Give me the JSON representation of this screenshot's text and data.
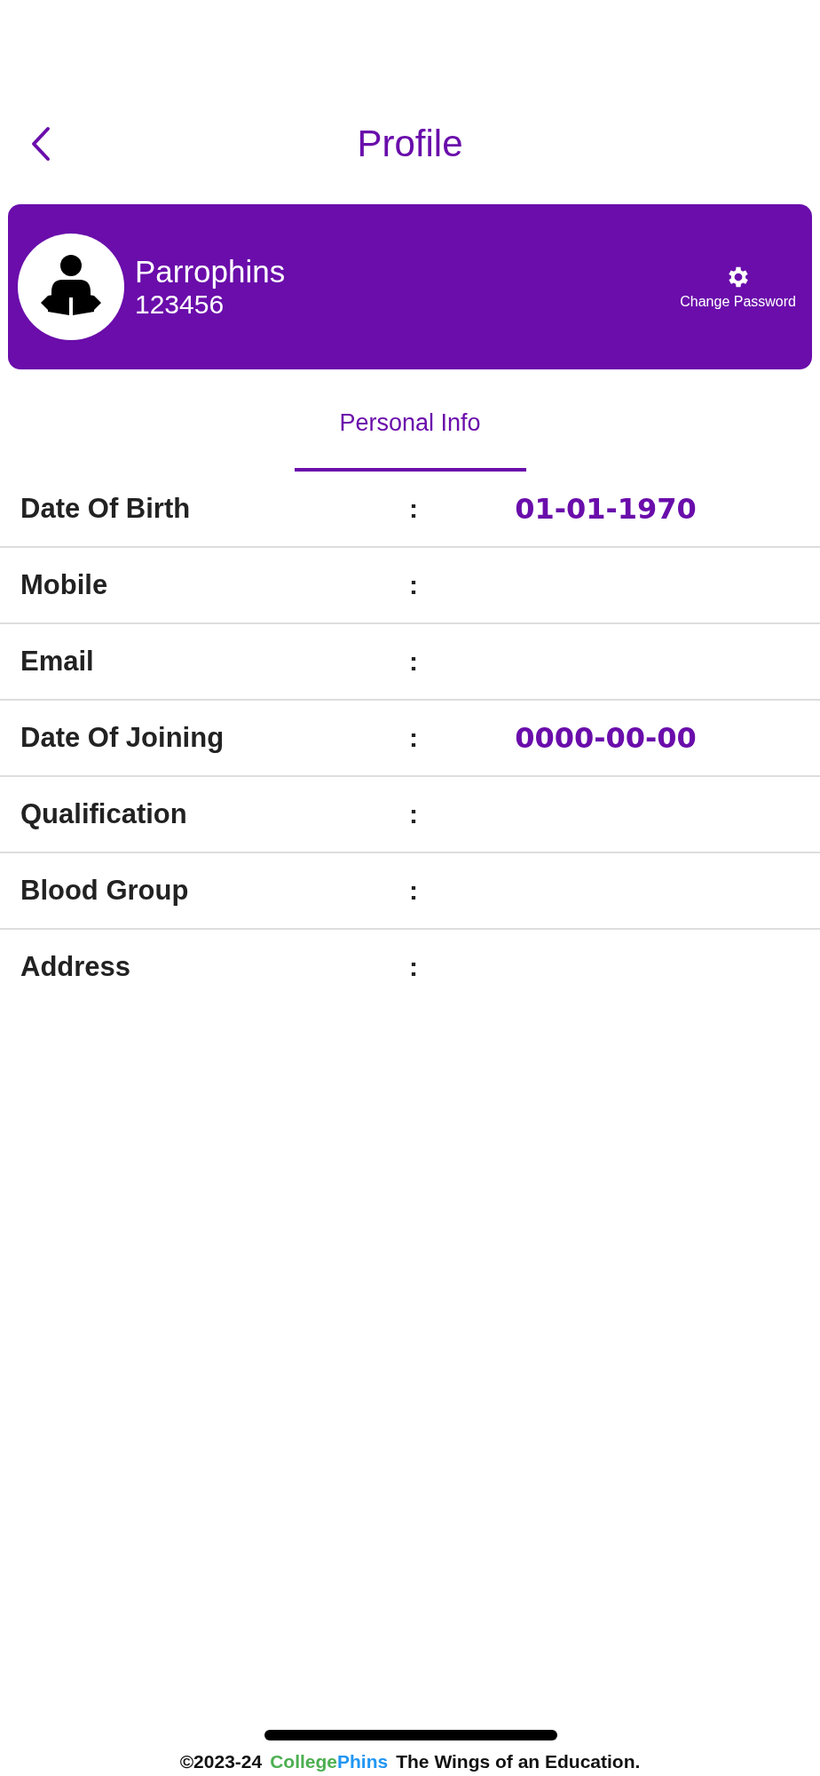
{
  "header": {
    "title": "Profile"
  },
  "profile": {
    "name": "Parrophins",
    "id": "123456",
    "action": "Change Password"
  },
  "tabs": [
    {
      "label": "Personal Info",
      "selected": true
    }
  ],
  "fields": [
    {
      "label": "Date Of Birth",
      "separator": ":",
      "value": "01-01-1970"
    },
    {
      "label": "Mobile",
      "separator": ":"
    },
    {
      "label": "Email",
      "separator": ":"
    },
    {
      "label": "Date Of Joining",
      "separator": ":",
      "value": "0000-00-00"
    },
    {
      "label": "Qualification",
      "separator": ":"
    },
    {
      "label": "Blood Group",
      "separator": ":"
    },
    {
      "label": "Address",
      "separator": ":"
    }
  ],
  "footer": {
    "copyright": "©2023-24",
    "brand": [
      {
        "text": "College",
        "color": "#4caf50"
      },
      {
        "text": "Phins",
        "color": "#2196f3"
      }
    ],
    "tagline": "The Wings of an Education."
  }
}
